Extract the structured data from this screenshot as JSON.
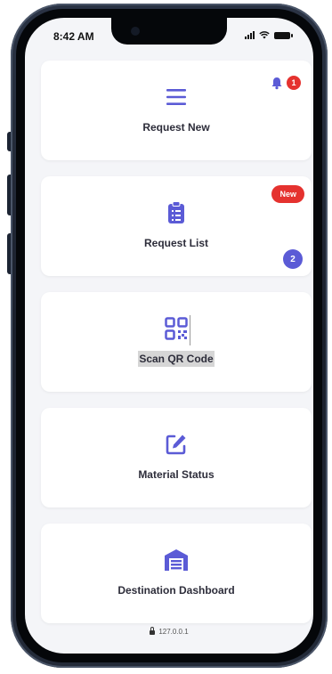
{
  "status_bar": {
    "time": "8:42 AM"
  },
  "colors": {
    "accent": "#5b5bd6",
    "badge_red": "#e5322f",
    "screen_bg": "#f4f5f8"
  },
  "cards": [
    {
      "label": "Request New",
      "icon": "hamburger-menu-icon"
    },
    {
      "label": "Request List",
      "icon": "clipboard-icon",
      "badge_new": "New",
      "badge_count": "2"
    },
    {
      "label": "Scan QR Code",
      "icon": "qr-code-icon"
    },
    {
      "label": "Material Status",
      "icon": "edit-icon"
    },
    {
      "label": "Destination Dashboard",
      "icon": "warehouse-icon"
    }
  ],
  "notifications": {
    "icon": "bell-icon",
    "count": "1"
  },
  "url": "127.0.0.1"
}
